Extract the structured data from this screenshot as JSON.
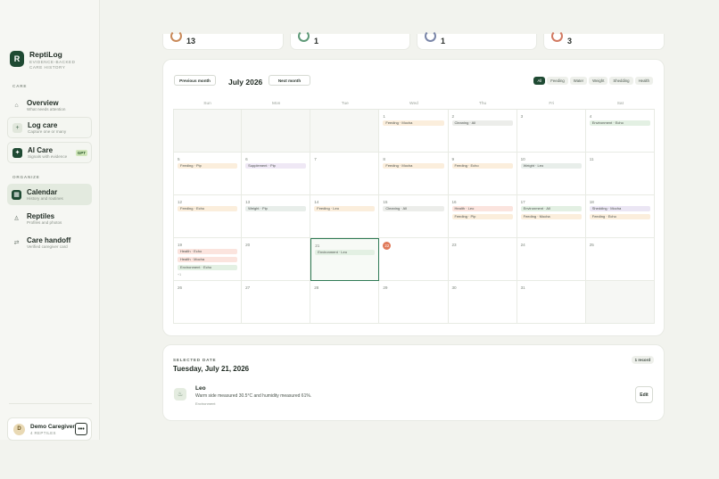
{
  "brand": {
    "name": "ReptiLog",
    "tagline": "EVIDENCE-BACKED CARE HISTORY",
    "logo_letter": "R"
  },
  "sidebar": {
    "section_care": "CARE",
    "section_organize": "ORGANIZE",
    "items": [
      {
        "title": "Overview",
        "subtitle": "What needs attention",
        "icon": "home-icon"
      },
      {
        "title": "Log care",
        "subtitle": "Capture one or many",
        "icon": "plus-icon"
      },
      {
        "title": "AI Care",
        "subtitle": "Signals with evidence",
        "icon": "sparkle-icon",
        "badge": "GPT"
      },
      {
        "title": "Calendar",
        "subtitle": "History and routines",
        "icon": "calendar-icon"
      },
      {
        "title": "Reptiles",
        "subtitle": "Profiles and photos",
        "icon": "reptile-icon"
      },
      {
        "title": "Care handoff",
        "subtitle": "Verified caregiver card",
        "icon": "swap-icon"
      }
    ],
    "user": {
      "initial": "D",
      "name": "Demo Caregiver",
      "subtitle": "4 REPTILES",
      "menu": "•••"
    }
  },
  "stats": [
    {
      "value": "13",
      "color": "#c98a5a"
    },
    {
      "value": "1",
      "color": "#5f9a78"
    },
    {
      "value": "1",
      "color": "#7a86a8"
    },
    {
      "value": "3",
      "color": "#d27a62"
    }
  ],
  "calendar": {
    "prev_label": "Previous month",
    "next_label": "Next month",
    "month_title": "July 2026",
    "filters": [
      "All",
      "Feeding",
      "Water",
      "Weight",
      "Shedding",
      "Health"
    ],
    "weekdays": [
      "Sun",
      "Mon",
      "Tue",
      "Wed",
      "Thu",
      "Fri",
      "Sat"
    ],
    "weeks": [
      [
        {
          "blank": true
        },
        {
          "blank": true
        },
        {
          "blank": true
        },
        {
          "day": "1",
          "events": [
            {
              "type": "feeding",
              "label": "Feeding · Mocha"
            }
          ]
        },
        {
          "day": "2",
          "events": [
            {
              "type": "cleaning",
              "label": "Cleaning · All"
            }
          ]
        },
        {
          "day": "3",
          "events": []
        },
        {
          "day": "4",
          "events": [
            {
              "type": "environment",
              "label": "Environment · Echo"
            }
          ]
        }
      ],
      [
        {
          "day": "5",
          "events": [
            {
              "type": "feeding",
              "label": "Feeding · Pip"
            }
          ]
        },
        {
          "day": "6",
          "events": [
            {
              "type": "supplement",
              "label": "Supplement · Pip"
            }
          ]
        },
        {
          "day": "7",
          "events": []
        },
        {
          "day": "8",
          "events": [
            {
              "type": "feeding",
              "label": "Feeding · Mocha"
            }
          ]
        },
        {
          "day": "9",
          "events": [
            {
              "type": "feeding",
              "label": "Feeding · Echo"
            }
          ]
        },
        {
          "day": "10",
          "events": [
            {
              "type": "weight",
              "label": "Weight · Leo"
            }
          ]
        },
        {
          "day": "11",
          "events": []
        }
      ],
      [
        {
          "day": "12",
          "events": [
            {
              "type": "feeding",
              "label": "Feeding · Echo"
            }
          ]
        },
        {
          "day": "13",
          "events": [
            {
              "type": "weight",
              "label": "Weight · Pip"
            }
          ]
        },
        {
          "day": "14",
          "events": [
            {
              "type": "feeding",
              "label": "Feeding · Leo"
            }
          ]
        },
        {
          "day": "15",
          "events": [
            {
              "type": "cleaning",
              "label": "Cleaning · All"
            }
          ]
        },
        {
          "day": "16",
          "events": [
            {
              "type": "health",
              "label": "Health · Leo"
            },
            {
              "type": "feeding",
              "label": "Feeding · Pip"
            }
          ]
        },
        {
          "day": "17",
          "events": [
            {
              "type": "environment",
              "label": "Environment · All"
            },
            {
              "type": "feeding",
              "label": "Feeding · Mocha"
            }
          ]
        },
        {
          "day": "18",
          "events": [
            {
              "type": "shedding",
              "label": "Shedding · Mocha"
            },
            {
              "type": "feeding",
              "label": "Feeding · Echo"
            }
          ]
        }
      ],
      [
        {
          "day": "19",
          "events": [
            {
              "type": "health",
              "label": "Health · Echo"
            },
            {
              "type": "health",
              "label": "Health · Mocha"
            },
            {
              "type": "environment",
              "label": "Environment · Echo"
            }
          ],
          "more": "+1"
        },
        {
          "day": "20",
          "events": []
        },
        {
          "day": "21",
          "selected": true,
          "events": [
            {
              "type": "environment",
              "label": "Environment · Leo"
            }
          ]
        },
        {
          "day": "22",
          "today": true,
          "events": []
        },
        {
          "day": "23",
          "events": []
        },
        {
          "day": "24",
          "events": []
        },
        {
          "day": "25",
          "events": []
        }
      ],
      [
        {
          "day": "26",
          "events": []
        },
        {
          "day": "27",
          "events": []
        },
        {
          "day": "28",
          "events": []
        },
        {
          "day": "29",
          "events": []
        },
        {
          "day": "30",
          "events": []
        },
        {
          "day": "31",
          "events": []
        },
        {
          "blank": true
        }
      ]
    ]
  },
  "selected": {
    "label": "SELECTED DATE",
    "date": "Tuesday, July 21, 2026",
    "record_count": "1 record",
    "record": {
      "name": "Leo",
      "text": "Warm side measured 30.5°C and humidity measured 61%.",
      "category": "Environment",
      "edit_label": "Edit",
      "icon": "thermometer-icon"
    }
  }
}
